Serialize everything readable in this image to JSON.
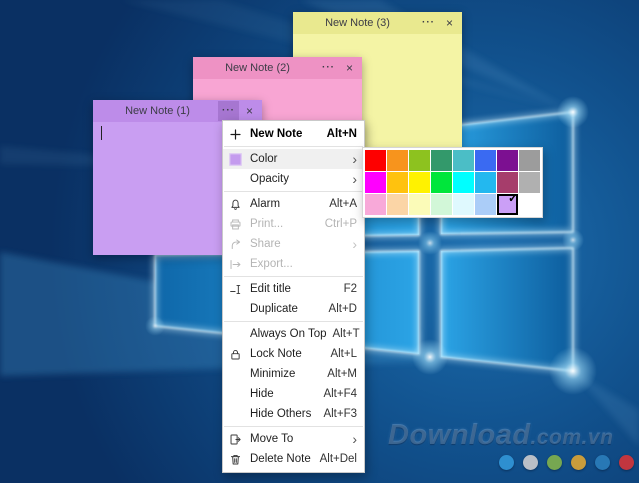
{
  "watermark": {
    "main": "Download",
    "suffix": ".com.vn",
    "dots": [
      "#2E8FD0",
      "#B9BFC7",
      "#76A751",
      "#C89C3C",
      "#2878B5",
      "#C2363F"
    ]
  },
  "notes": [
    {
      "title": "New Note (1)",
      "header_color": "#BD8CE9",
      "body_color": "#C99EF2",
      "menu_glyph": "···",
      "close_glyph": "×"
    },
    {
      "title": "New Note (2)",
      "header_color": "#EE92C4",
      "body_color": "#F8A5D3",
      "menu_glyph": "···",
      "close_glyph": "×"
    },
    {
      "title": "New Note (3)",
      "header_color": "#E9E98F",
      "body_color": "#F4F4A5",
      "menu_glyph": "···",
      "close_glyph": "×"
    }
  ],
  "context_menu": {
    "chevron_glyph": "›",
    "items": [
      {
        "label": "New Note",
        "shortcut": "Alt+N"
      },
      {
        "label": "Color",
        "shortcut": ""
      },
      {
        "label": "Opacity",
        "shortcut": ""
      },
      {
        "label": "Alarm",
        "shortcut": "Alt+A"
      },
      {
        "label": "Print...",
        "shortcut": "Ctrl+P"
      },
      {
        "label": "Share",
        "shortcut": ""
      },
      {
        "label": "Export...",
        "shortcut": ""
      },
      {
        "label": "Edit title",
        "shortcut": "F2"
      },
      {
        "label": "Duplicate",
        "shortcut": "Alt+D"
      },
      {
        "label": "Always On Top",
        "shortcut": "Alt+T"
      },
      {
        "label": "Lock Note",
        "shortcut": "Alt+L"
      },
      {
        "label": "Minimize",
        "shortcut": "Alt+M"
      },
      {
        "label": "Hide",
        "shortcut": "Alt+F4"
      },
      {
        "label": "Hide Others",
        "shortcut": "Alt+F3"
      },
      {
        "label": "Move To",
        "shortcut": ""
      },
      {
        "label": "Delete Note",
        "shortcut": "Alt+Del"
      }
    ],
    "color_icon_swatch": "#C49BEE"
  },
  "color_palette": {
    "rows": [
      [
        "#FE0000",
        "#F7941D",
        "#8DC21F",
        "#33996B",
        "#4BBEC6",
        "#3A6AF2",
        "#7C1091",
        "#9C9C9C"
      ],
      [
        "#FF00FE",
        "#FFC20E",
        "#FFF200",
        "#00E63B",
        "#00FFFF",
        "#23B8EF",
        "#A63D6B",
        "#B0B0B0"
      ],
      [
        "#F8A9D9",
        "#FBD5A6",
        "#FBFBB8",
        "#D2F7D8",
        "#DFF9FE",
        "#ABCDF8",
        "#CB9FF6",
        "#FFFFFF"
      ]
    ],
    "selected_index": 22,
    "check_glyph": "✓"
  }
}
